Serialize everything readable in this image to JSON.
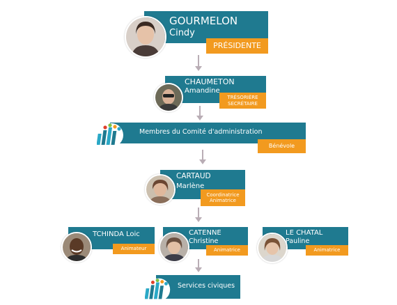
{
  "nodes": {
    "president": {
      "last": "GOURMELON",
      "first": "Cindy",
      "role": [
        "PRÉSIDENTE"
      ]
    },
    "treasurer": {
      "last": "CHAUMETON",
      "first": "Amandine",
      "role": [
        "TRÉSORIÈRE",
        "SECRÉTAIRE"
      ]
    },
    "committee": {
      "label": "Membres du Comité d'administration",
      "role": [
        "Bénévole"
      ]
    },
    "coordinator": {
      "last": "CARTAUD",
      "first": "Marlène",
      "role": [
        "Coordinatrice",
        "Animatrice"
      ]
    },
    "tchinda": {
      "label": "TCHINDA Loic",
      "role": [
        "Animateur"
      ]
    },
    "catenne": {
      "last": "CATENNE",
      "first": "Christine",
      "role": [
        "Animatrice"
      ]
    },
    "lechatal": {
      "last": "LE CHATAL",
      "first": "Pauline",
      "role": [
        "Animatrice"
      ]
    },
    "civic": {
      "label": "Services civiques"
    }
  },
  "colors": {
    "card": "#1f7a90",
    "role": "#f29a1f",
    "arrow": "#b9adb5"
  }
}
